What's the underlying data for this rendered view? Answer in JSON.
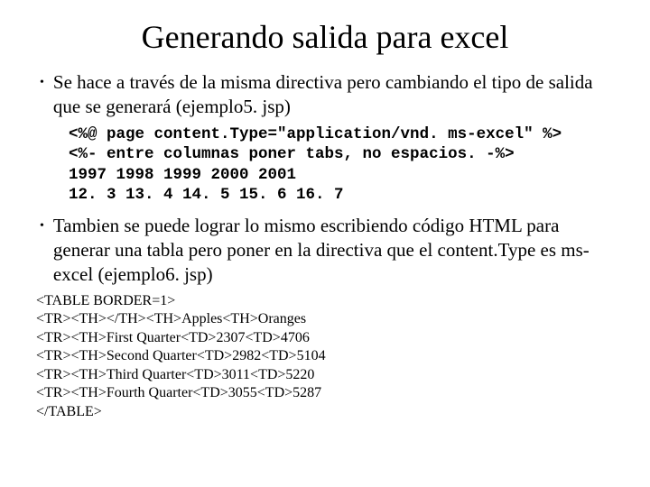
{
  "title": "Generando salida para excel",
  "bullet1": "Se hace a través de la misma directiva pero cambiando el tipo de salida que se generará (ejemplo5. jsp)",
  "code1": "<%@ page content.Type=\"application/vnd. ms-excel\" %>\n<%- entre columnas poner tabs, no espacios. -%>\n1997 1998 1999 2000 2001\n12. 3 13. 4 14. 5 15. 6 16. 7",
  "bullet2": "Tambien se puede lograr lo mismo escribiendo código HTML para generar una tabla pero poner en la directiva que el content.Type es ms-excel (ejemplo6. jsp)",
  "code2": "<TABLE BORDER=1>\n<TR><TH></TH><TH>Apples<TH>Oranges\n<TR><TH>First Quarter<TD>2307<TD>4706\n<TR><TH>Second Quarter<TD>2982<TD>5104\n<TR><TH>Third Quarter<TD>3011<TD>5220\n<TR><TH>Fourth Quarter<TD>3055<TD>5287\n</TABLE>"
}
